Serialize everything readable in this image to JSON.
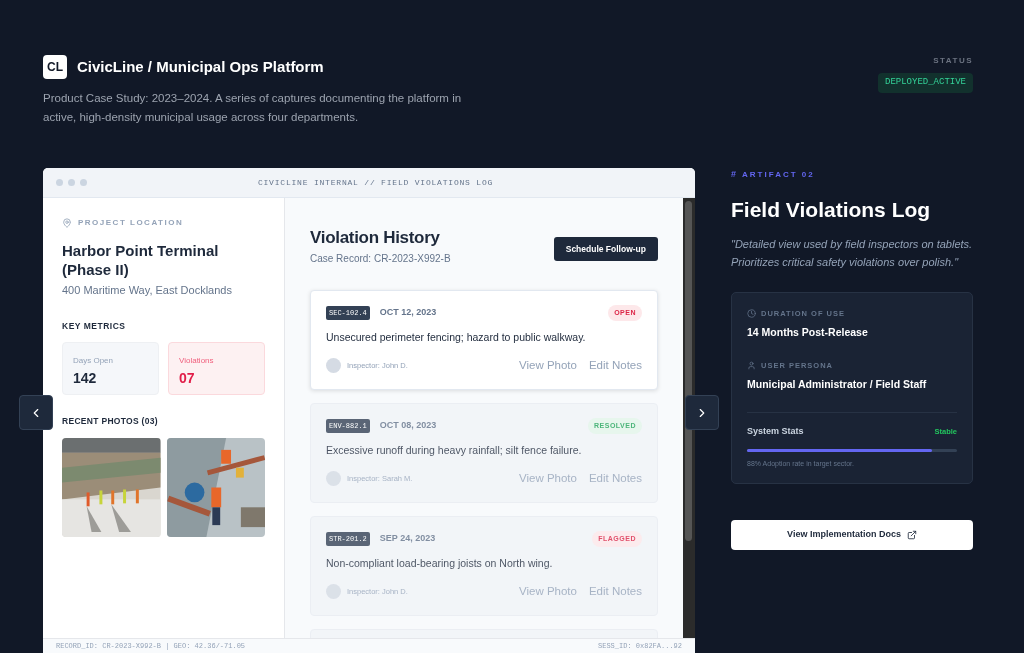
{
  "header": {
    "logo": "CL",
    "title": "CivicLine / Municipal Ops Platform",
    "description": "Product Case Study: 2023–2024. A series of captures documenting the platform in active, high-density municipal usage across four departments.",
    "status_label": "STATUS",
    "status": "DEPLOYED_ACTIVE"
  },
  "window": {
    "title": "CIVICLINE INTERNAL // FIELD VIOLATIONS LOG",
    "location": {
      "label": "PROJECT LOCATION",
      "name": "Harbor Point Terminal (Phase II)",
      "address": "400 Maritime Way, East Docklands"
    },
    "metrics_title": "KEY METRICS",
    "metrics": [
      {
        "label": "Days Open",
        "value": "142",
        "kind": "neutral"
      },
      {
        "label": "Violations",
        "value": "07",
        "kind": "alert"
      }
    ],
    "photos_title": "RECENT PHOTOS (03)",
    "history_title": "Violation History",
    "case_record": "Case Record: CR-2023-X992-B",
    "schedule_button": "Schedule Follow-up",
    "violations": [
      {
        "code": "SEC-102.4",
        "date": "OCT 12, 2023",
        "status": "OPEN",
        "kind": "open",
        "selected": true,
        "description": "Unsecured perimeter fencing; hazard to public walkway.",
        "inspector": "Inspector: John D.",
        "actions": [
          "View Photo",
          "Edit Notes"
        ]
      },
      {
        "code": "ENV-882.1",
        "date": "OCT 08, 2023",
        "status": "RESOLVED",
        "kind": "resolved",
        "selected": false,
        "description": "Excessive runoff during heavy rainfall; silt fence failure.",
        "inspector": "Inspector: Sarah M.",
        "actions": [
          "View Photo",
          "Edit Notes"
        ]
      },
      {
        "code": "STR-201.2",
        "date": "SEP 24, 2023",
        "status": "FLAGGED",
        "kind": "flagged",
        "selected": false,
        "description": "Non-compliant load-bearing joists on North wing.",
        "inspector": "Inspector: John D.",
        "actions": [
          "View Photo",
          "Edit Notes"
        ]
      }
    ],
    "footer_left": "RECORD_ID: CR-2023-X992-B | GEO: 42.36/-71.05",
    "footer_right": "SESS_ID: 0x82FA...92"
  },
  "artifact": {
    "hash": "#",
    "label": "ARTIFACT 02",
    "title": "Field Violations Log",
    "quote": "\"Detailed view used by field inspectors on tablets. Prioritizes critical safety violations over polish.\"",
    "duration_label": "DURATION OF USE",
    "duration": "14 Months Post-Release",
    "persona_label": "USER PERSONA",
    "persona": "Municipal Administrator / Field Staff",
    "stats_label": "System Stats",
    "stats_status": "Stable",
    "level": 0.88,
    "stats_note": "88% Adoption rate in target sector.",
    "docs_button": "View Implementation Docs"
  }
}
